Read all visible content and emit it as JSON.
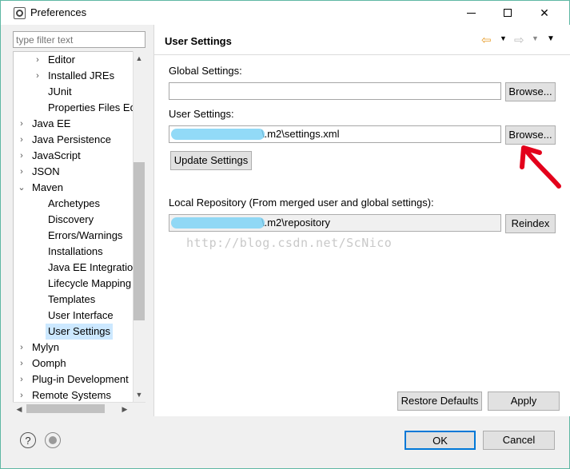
{
  "window": {
    "title": "Preferences"
  },
  "filter": {
    "placeholder": "type filter text"
  },
  "tree": [
    {
      "label": "Editor",
      "level": 1,
      "arrow": "›"
    },
    {
      "label": "Installed JREs",
      "level": 1,
      "arrow": "›"
    },
    {
      "label": "JUnit",
      "level": 1,
      "arrow": ""
    },
    {
      "label": "Properties Files Ed",
      "level": 1,
      "arrow": ""
    },
    {
      "label": "Java EE",
      "level": 0,
      "arrow": "›"
    },
    {
      "label": "Java Persistence",
      "level": 0,
      "arrow": "›"
    },
    {
      "label": "JavaScript",
      "level": 0,
      "arrow": "›"
    },
    {
      "label": "JSON",
      "level": 0,
      "arrow": "›"
    },
    {
      "label": "Maven",
      "level": 0,
      "arrow": "⌄"
    },
    {
      "label": "Archetypes",
      "level": 1,
      "arrow": ""
    },
    {
      "label": "Discovery",
      "level": 1,
      "arrow": ""
    },
    {
      "label": "Errors/Warnings",
      "level": 1,
      "arrow": ""
    },
    {
      "label": "Installations",
      "level": 1,
      "arrow": ""
    },
    {
      "label": "Java EE Integration",
      "level": 1,
      "arrow": ""
    },
    {
      "label": "Lifecycle Mapping",
      "level": 1,
      "arrow": ""
    },
    {
      "label": "Templates",
      "level": 1,
      "arrow": ""
    },
    {
      "label": "User Interface",
      "level": 1,
      "arrow": ""
    },
    {
      "label": "User Settings",
      "level": 1,
      "arrow": "",
      "selected": true
    },
    {
      "label": "Mylyn",
      "level": 0,
      "arrow": "›"
    },
    {
      "label": "Oomph",
      "level": 0,
      "arrow": "›"
    },
    {
      "label": "Plug-in Development",
      "level": 0,
      "arrow": "›"
    },
    {
      "label": "Remote Systems",
      "level": 0,
      "arrow": "›"
    }
  ],
  "page": {
    "title": "User Settings",
    "global_settings_label": "Global Settings:",
    "global_settings_value": "",
    "browse_label": "Browse...",
    "user_settings_label": "User Settings:",
    "user_settings_value": "\\.m2\\settings.xml",
    "update_settings_label": "Update Settings",
    "local_repo_label": "Local Repository (From merged user and global settings):",
    "local_repo_value": "\\.m2\\repository",
    "reindex_label": "Reindex",
    "watermark": "http://blog.csdn.net/ScNico",
    "restore_defaults_label": "Restore Defaults",
    "apply_label": "Apply"
  },
  "footer": {
    "ok_label": "OK",
    "cancel_label": "Cancel"
  },
  "colors": {
    "accent": "#0078d7",
    "selection": "#cce8ff",
    "redaction": "#7fd4f6",
    "arrow_annotation": "#e3001b"
  }
}
